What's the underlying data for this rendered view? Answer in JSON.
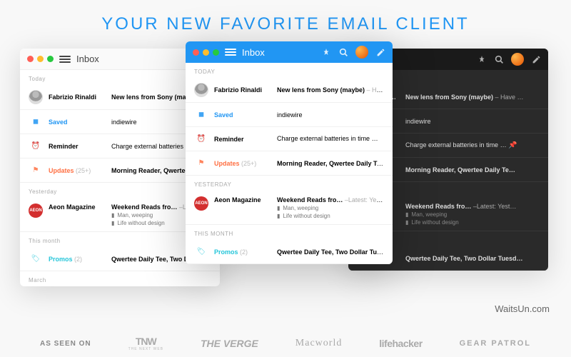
{
  "headline": "YOUR NEW FAVORITE EMAIL CLIENT",
  "watermark": "WaitsUn.com",
  "titlebar": {
    "title": "Inbox"
  },
  "sections": {
    "today": "Today",
    "today_uc": "TODAY",
    "yesterday": "Yesterday",
    "yesterday_uc": "YESTERDAY",
    "this_month": "This month",
    "this_month_uc": "THIS MONTH",
    "march": "March"
  },
  "rows": {
    "fabrizio": {
      "sender": "Fabrizio Rinaldi",
      "subject": "New lens from Sony (maybe)",
      "preview": " – Have …"
    },
    "saved": {
      "sender": "Saved",
      "subject": "indiewire"
    },
    "reminder": {
      "sender": "Reminder",
      "subject": "Charge external batteries in time …"
    },
    "updates": {
      "sender": "Updates",
      "count": " (25+)",
      "subject": "Morning Reader, Qwertee Daily Te…"
    },
    "aeon": {
      "sender": "Aeon Magazine",
      "subject": "Weekend Reads fro…",
      "preview": " –Latest: Yest…",
      "attach1": "Man, weeping",
      "attach2": "Life without design",
      "logo": "AEON"
    },
    "promos": {
      "sender": "Promos",
      "count": " (2)",
      "subject": "Qwertee Daily Tee, Two Dollar Tuesd…"
    }
  },
  "footer": {
    "asseen": "AS SEEN ON",
    "tnw": "TNW",
    "tnw_sub": "THE NEXT WEB",
    "verge": "THE VERGE",
    "macworld": "Macworld",
    "lifehacker": "lifehacker",
    "gear": "GEAR PATROL"
  }
}
